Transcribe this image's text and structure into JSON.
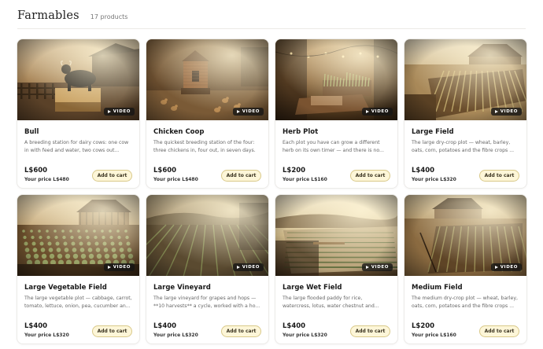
{
  "page": {
    "title": "Farmables",
    "count": "17 products"
  },
  "common": {
    "video_label": "VIDEO",
    "cart_label": "Add to cart"
  },
  "products": [
    {
      "name": "Bull",
      "desc": "A breeding station for dairy cows: one cow in with feed and water, two cows out...",
      "price": "L$600",
      "your_price": "Your price L$480",
      "scene": "bull"
    },
    {
      "name": "Chicken Coop",
      "desc": "The quickest breeding station of the four: three chickens in, four out, in seven days.",
      "price": "L$600",
      "your_price": "Your price L$480",
      "scene": "coop"
    },
    {
      "name": "Herb Plot",
      "desc": "Each plot you have can grow a different herb on its own timer — and there is no...",
      "price": "L$200",
      "your_price": "Your price L$160",
      "scene": "herb"
    },
    {
      "name": "Large Field",
      "desc": "The large dry-crop plot — wheat, barley, oats, corn, potatoes and the fibre crops ...",
      "price": "L$400",
      "your_price": "Your price L$320",
      "scene": "field"
    },
    {
      "name": "Large Vegetable Field",
      "desc": "The large vegetable plot — cabbage, carrot, tomato, lettuce, onion, pea, cucumber an...",
      "price": "L$400",
      "your_price": "Your price L$320",
      "scene": "veg"
    },
    {
      "name": "Large Vineyard",
      "desc": "The large vineyard for grapes and hops — **10 harvests** a cycle, worked with a ho...",
      "price": "L$400",
      "your_price": "Your price L$320",
      "scene": "vine"
    },
    {
      "name": "Large Wet Field",
      "desc": "The large flooded paddy for rice, watercress, lotus, water chestnut and...",
      "price": "L$400",
      "your_price": "Your price L$320",
      "scene": "wet"
    },
    {
      "name": "Medium Field",
      "desc": "The medium dry-crop plot — wheat, barley, oats, corn, potatoes and the fibre crops ...",
      "price": "L$200",
      "your_price": "Your price L$160",
      "scene": "medium"
    }
  ]
}
